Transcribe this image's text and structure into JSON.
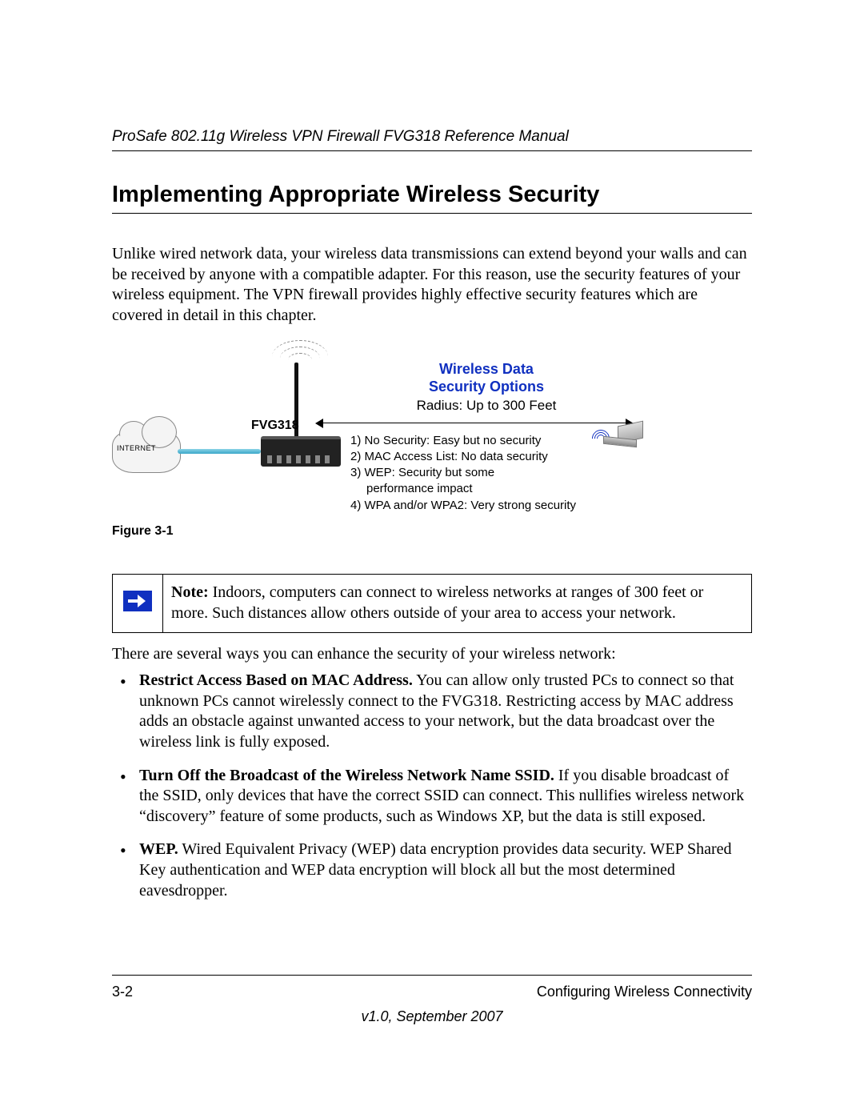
{
  "header": {
    "running_head": "ProSafe 802.11g Wireless VPN Firewall FVG318 Reference Manual"
  },
  "section": {
    "title": "Implementing Appropriate Wireless Security",
    "intro": "Unlike wired network data, your wireless data transmissions can extend beyond your walls and can be received by anyone with a compatible adapter. For this reason, use the security features of your wireless equipment. The VPN firewall provides highly effective security features which are covered in detail in this chapter."
  },
  "diagram": {
    "internet_label": "INTERNET",
    "device_label": "FVG318",
    "title_line1": "Wireless Data",
    "title_line2": "Security Options",
    "radius": "Radius: Up to 300 Feet",
    "options": [
      "1) No Security: Easy but no security",
      "2) MAC Access List: No data security",
      "3) WEP: Security but some",
      "performance impact",
      "4) WPA and/or WPA2: Very strong security"
    ],
    "caption": "Figure 3-1"
  },
  "note": {
    "label": "Note:",
    "text": " Indoors, computers can connect to wireless networks at ranges of 300 feet or more. Such distances allow others outside of your area to access your network."
  },
  "after_note": "There are several ways you can enhance the security of your wireless network:",
  "bullets": [
    {
      "head": "Restrict Access Based on MAC Address.",
      "body": " You can allow only trusted PCs to connect so that unknown PCs cannot wirelessly connect to the FVG318. Restricting access by MAC address adds an obstacle against unwanted access to your network, but the data broadcast over the wireless link is fully exposed."
    },
    {
      "head": "Turn Off the Broadcast of the Wireless Network Name SSID.",
      "body": " If you disable broadcast of the SSID, only devices that have the correct SSID can connect. This nullifies wireless network “discovery” feature of some products, such as Windows XP, but the data is still exposed."
    },
    {
      "head": "WEP.",
      "body": " Wired Equivalent Privacy (WEP) data encryption provides data security. WEP Shared Key authentication and WEP data encryption will block all but the most determined eavesdropper."
    }
  ],
  "footer": {
    "page": "3-2",
    "chapter": "Configuring Wireless Connectivity",
    "version": "v1.0, September 2007"
  }
}
